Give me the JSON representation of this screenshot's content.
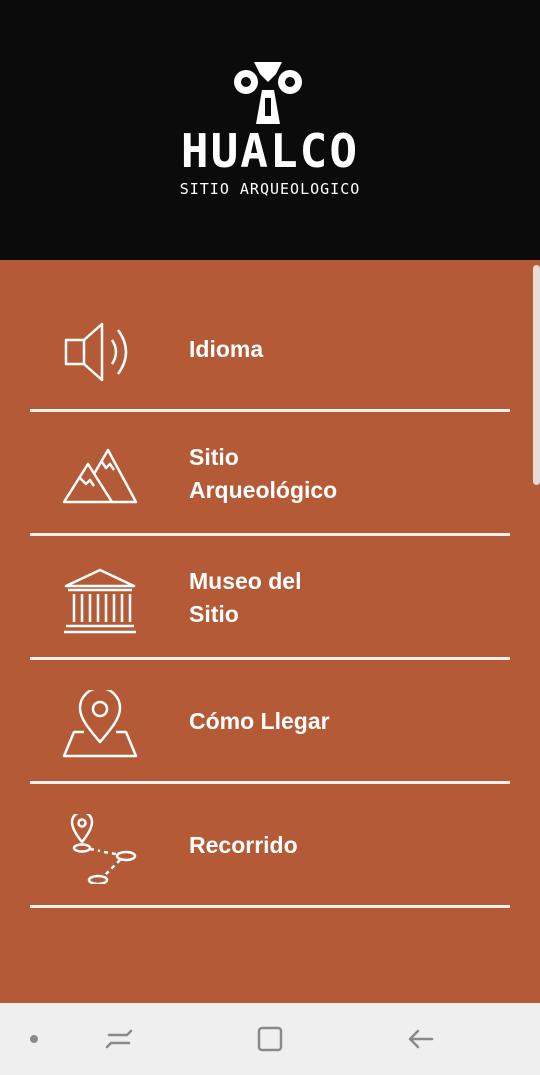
{
  "header": {
    "brand": "HUALCO",
    "subtitle": "SITIO ARQUEOLOGICO"
  },
  "menu": {
    "items": [
      {
        "label": "Idioma",
        "icon": "speaker-icon"
      },
      {
        "label": "Sitio\nArqueológico",
        "icon": "mountains-icon"
      },
      {
        "label": "Museo del\nSitio",
        "icon": "museum-icon"
      },
      {
        "label": "Cómo Llegar",
        "icon": "map-pin-icon"
      },
      {
        "label": "Recorrido",
        "icon": "route-icon"
      }
    ]
  },
  "colors": {
    "header_bg": "#0b0b0b",
    "menu_bg": "#b55a37",
    "text": "#ffffff",
    "navbar_bg": "#efefef"
  },
  "navbar": {
    "items": [
      "dot-indicator",
      "recent-apps-icon",
      "home-icon",
      "back-icon"
    ]
  }
}
